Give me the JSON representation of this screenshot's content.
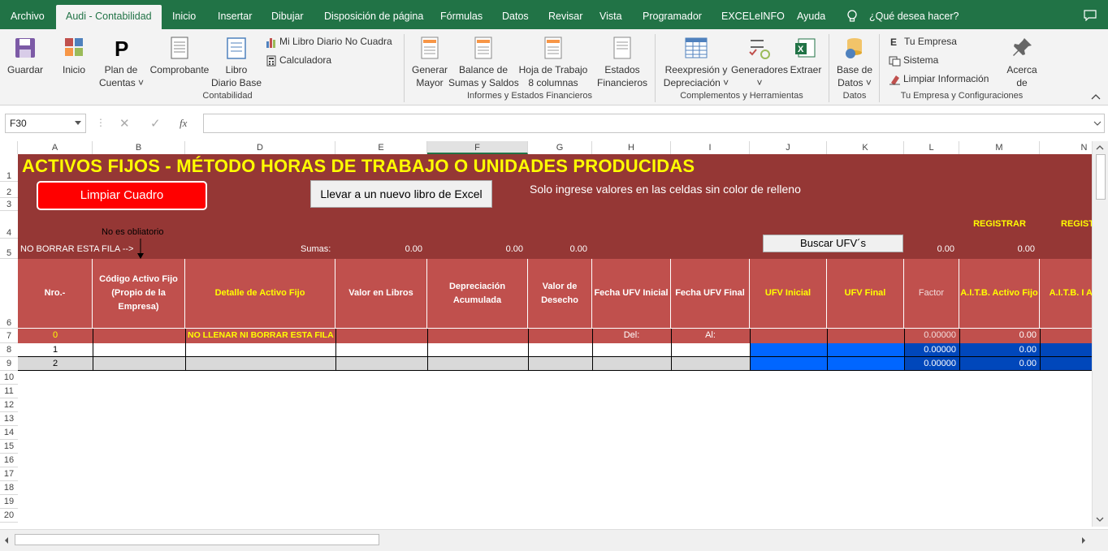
{
  "menubar": {
    "tabs": [
      "Archivo",
      "Audi - Contabilidad",
      "Inicio",
      "Insertar",
      "Dibujar",
      "Disposición de página",
      "Fórmulas",
      "Datos",
      "Revisar",
      "Vista",
      "Programador",
      "EXCELeINFO",
      "Ayuda"
    ],
    "tellme": "¿Qué desea hacer?"
  },
  "ribbon": {
    "guardar": "Guardar",
    "inicio": "Inicio",
    "plan1": "Plan de",
    "plan2": "Cuentas",
    "comprobante": "Comprobante",
    "libro1": "Libro",
    "libro2": "Diario Base",
    "mi_libro": "Mi Libro Diario No Cuadra",
    "calculadora": "Calculadora",
    "group_contabilidad": "Contabilidad",
    "generar1": "Generar",
    "generar2": "Mayor",
    "balance1": "Balance de",
    "balance2": "Sumas y Saldos",
    "hoja1": "Hoja de Trabajo",
    "hoja2": "8 columnas",
    "estados1": "Estados",
    "estados2": "Financieros",
    "group_informes": "Informes y Estados Financieros",
    "reexp1": "Reexpresión y",
    "reexp2": "Depreciación",
    "generadores": "Generadores",
    "extraer": "Extraer",
    "group_complementos": "Complementos y Herramientas",
    "base1": "Base de",
    "base2": "Datos",
    "group_datos": "Datos",
    "tu_empresa": "Tu Empresa",
    "sistema": "Sistema",
    "limpiar_info": "Limpiar Información",
    "group_tuempresa": "Tu Empresa y Configuraciones",
    "acerca1": "Acerca",
    "acerca2": "de"
  },
  "formula_bar": {
    "namebox": "F30",
    "fx_label": "fx"
  },
  "columns": [
    "A",
    "B",
    "D",
    "E",
    "F",
    "G",
    "H",
    "I",
    "J",
    "K",
    "L",
    "M",
    "N"
  ],
  "rows": [
    "1",
    "2",
    "3",
    "4",
    "5",
    "6",
    "7",
    "8",
    "9",
    "10",
    "11",
    "12",
    "13",
    "14",
    "15",
    "16",
    "17",
    "18",
    "19",
    "20"
  ],
  "sheet": {
    "title": "ACTIVOS FIJOS - MÉTODO HORAS DE TRABAJO O UNIDADES PRODUCIDAS",
    "btn_limpiar": "Limpiar Cuadro",
    "btn_llevar": "Llevar a un nuevo libro de Excel",
    "hint": "Solo ingrese valores en las celdas sin color de relleno",
    "no_obligatorio": "No es obliatorio",
    "registrar1": "REGISTRAR",
    "registrar2": "REGISTI",
    "btn_buscar": "Buscar UFV´s",
    "no_borrar": "NO BORRAR ESTA FILA -->",
    "sumas_label": "Sumas:",
    "sumas": [
      "0.00",
      "0.00",
      "0.00",
      "0.00",
      "0.00"
    ],
    "headers": {
      "nro": "Nro.-",
      "codigo": "Código Activo Fijo (Propio de la Empresa)",
      "detalle": "Detalle de Activo Fijo",
      "valor_libros": "Valor en Libros",
      "depreciacion": "Depreciación Acumulada",
      "desecho": "Valor de Desecho",
      "ufv_ini_fecha": "Fecha UFV Inicial",
      "ufv_fin_fecha": "Fecha UFV Final",
      "ufv_inicial": "UFV Inicial",
      "ufv_final": "UFV Final",
      "factor": "Factor",
      "aitb_activo": "A.I.T.B. Activo Fijo",
      "aitb_acum": "A.I.T.B. I Acumul"
    },
    "row7": {
      "nro": "0",
      "detalle": "NO LLENAR NI BORRAR ESTA FILA",
      "del": "Del:",
      "al": "Al:",
      "factor": "0.00000",
      "aitb": "0.00"
    },
    "row8": {
      "nro": "1",
      "factor": "0.00000",
      "aitb": "0.00"
    },
    "row9": {
      "nro": "2",
      "factor": "0.00000",
      "aitb": "0.00"
    }
  },
  "colors": {
    "excel_green": "#217346",
    "sheet_bg": "#953735",
    "header_bg": "#c0504d",
    "title_yellow": "#ffff00",
    "ufv_blue": "#0066ff",
    "dark_blue": "#0047bb"
  }
}
